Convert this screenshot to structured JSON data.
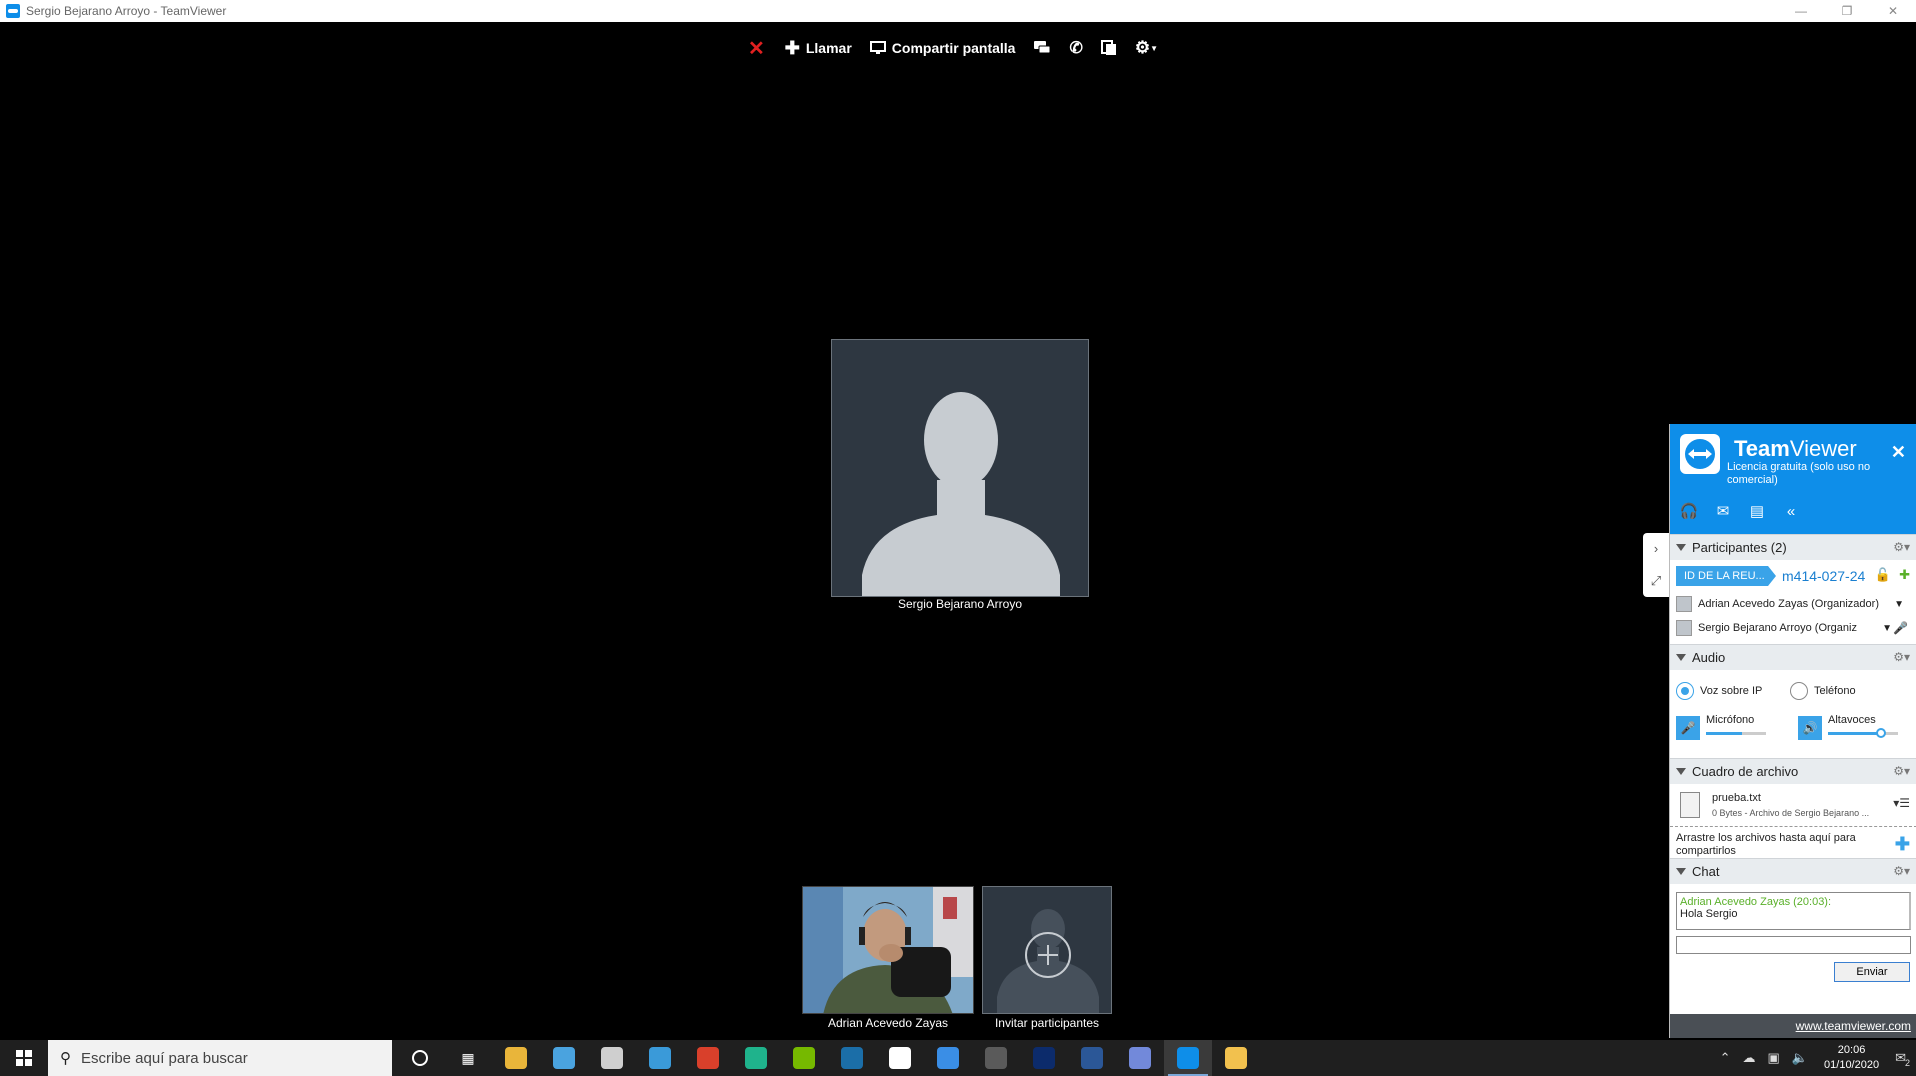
{
  "window": {
    "title": "Sergio Bejarano Arroyo - TeamViewer"
  },
  "toolbar": {
    "close_icon": "close-x-icon",
    "call_label": "Llamar",
    "share_label": "Compartir pantalla"
  },
  "main": {
    "participant_name": "Sergio Bejarano Arroyo"
  },
  "tiles": {
    "camera_name": "Adrian Acevedo Zayas",
    "invite_label": "Invitar participantes"
  },
  "panel": {
    "brand_bold": "Team",
    "brand_light": "Viewer",
    "license": "Licencia gratuita (solo uso no comercial)",
    "participants": {
      "header": "Participantes (2)",
      "meeting_tag": "ID DE LA REU...",
      "meeting_id": "m414-027-24",
      "items": [
        {
          "name": "Adrian Acevedo Zayas (Organizador)"
        },
        {
          "name": "Sergio Bejarano Arroyo (Organiz"
        }
      ]
    },
    "audio": {
      "header": "Audio",
      "voip_label": "Voz sobre IP",
      "phone_label": "Teléfono",
      "mic_label": "Micrófono",
      "speaker_label": "Altavoces",
      "mic_level": 0.6,
      "speaker_level": 0.75
    },
    "files": {
      "header": "Cuadro de archivo",
      "file_name": "prueba.txt",
      "file_desc": "0 Bytes - Archivo de Sergio Bejarano ...",
      "drop_hint": "Arrastre los archivos hasta aquí para compartirlos"
    },
    "chat": {
      "header": "Chat",
      "sender": "Adrian Acevedo Zayas (20:03):",
      "message": "Hola Sergio",
      "send_label": "Enviar"
    },
    "footer_link": "www.teamviewer.com"
  },
  "taskbar": {
    "search_placeholder": "Escribe aquí para buscar",
    "time": "20:06",
    "date": "01/10/2020",
    "notification_count": "2",
    "apps": [
      {
        "name": "chrome",
        "color": "#e9b53a"
      },
      {
        "name": "network-share",
        "color": "#4aa3df"
      },
      {
        "name": "obs",
        "color": "#cfcfcf"
      },
      {
        "name": "photos",
        "color": "#3a9ad9"
      },
      {
        "name": "filezilla",
        "color": "#d9402b"
      },
      {
        "name": "gitkraken",
        "color": "#1fb38c"
      },
      {
        "name": "nvidia",
        "color": "#76b900"
      },
      {
        "name": "steam",
        "color": "#1b6ea8"
      },
      {
        "name": "uplay",
        "color": "#ffffff"
      },
      {
        "name": "greenshot",
        "color": "#3a8ee6"
      },
      {
        "name": "terminal",
        "color": "#5a5a5a"
      },
      {
        "name": "photoshop",
        "color": "#0c2b6b"
      },
      {
        "name": "word",
        "color": "#2b5797"
      },
      {
        "name": "discord",
        "color": "#7289da"
      },
      {
        "name": "teamviewer",
        "color": "#0e8ee9"
      },
      {
        "name": "file-explorer",
        "color": "#f2c14e"
      }
    ]
  }
}
